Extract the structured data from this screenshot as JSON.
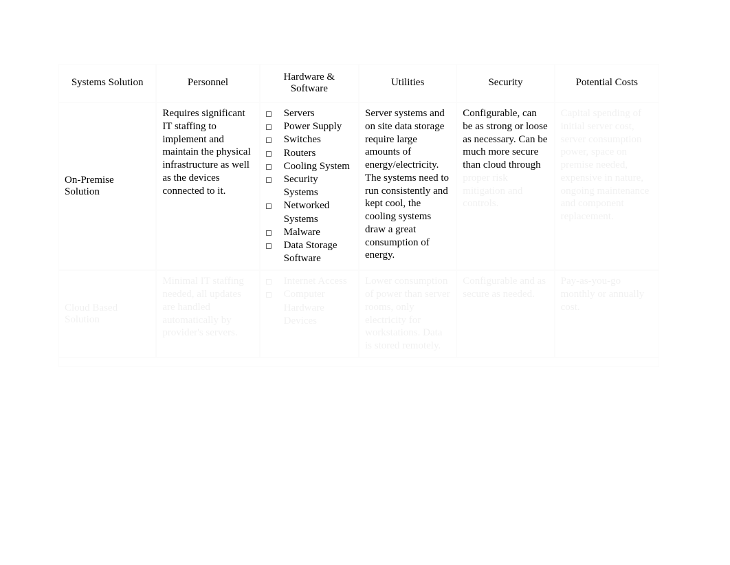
{
  "table": {
    "headers": {
      "systems": "Systems Solution",
      "personnel": "Personnel",
      "hardware": "Hardware & Software",
      "utilities": "Utilities",
      "security": "Security",
      "costs": "Potential Costs"
    },
    "rows": [
      {
        "system": "On-Premise Solution",
        "personnel": "Requires significant IT staffing to implement and maintain the physical infrastructure as well as the devices connected to it.",
        "hardware_items": [
          "Servers",
          "Power Supply",
          "Switches",
          "Routers",
          "Cooling System",
          "Security Systems",
          "Networked Systems",
          "Malware",
          "Data Storage Software"
        ],
        "utilities": "Server systems and on site data storage require large amounts of energy/electricity. The systems need to run consistently and kept cool, the cooling systems draw a great consumption of energy.",
        "security": "Configurable, can be as strong or loose as necessary. Can be much more secure than cloud through proper risk mitigation and controls.",
        "costs": "Capital spending of initial server cost, server consumption power, space on premise needed, expensive in nature, ongoing maintenance and component replacement."
      },
      {
        "system": "Cloud Based Solution",
        "personnel": "Minimal IT staffing needed, all updates are handled automatically by provider's servers.",
        "hardware_items": [
          "Internet Access",
          "Computer Hardware Devices"
        ],
        "utilities": "Lower consumption of power than server rooms, only electricity for workstations. Data is stored remotely.",
        "security": "Configurable and as secure as needed.",
        "costs": "Pay-as-you-go monthly or annually cost."
      }
    ]
  }
}
